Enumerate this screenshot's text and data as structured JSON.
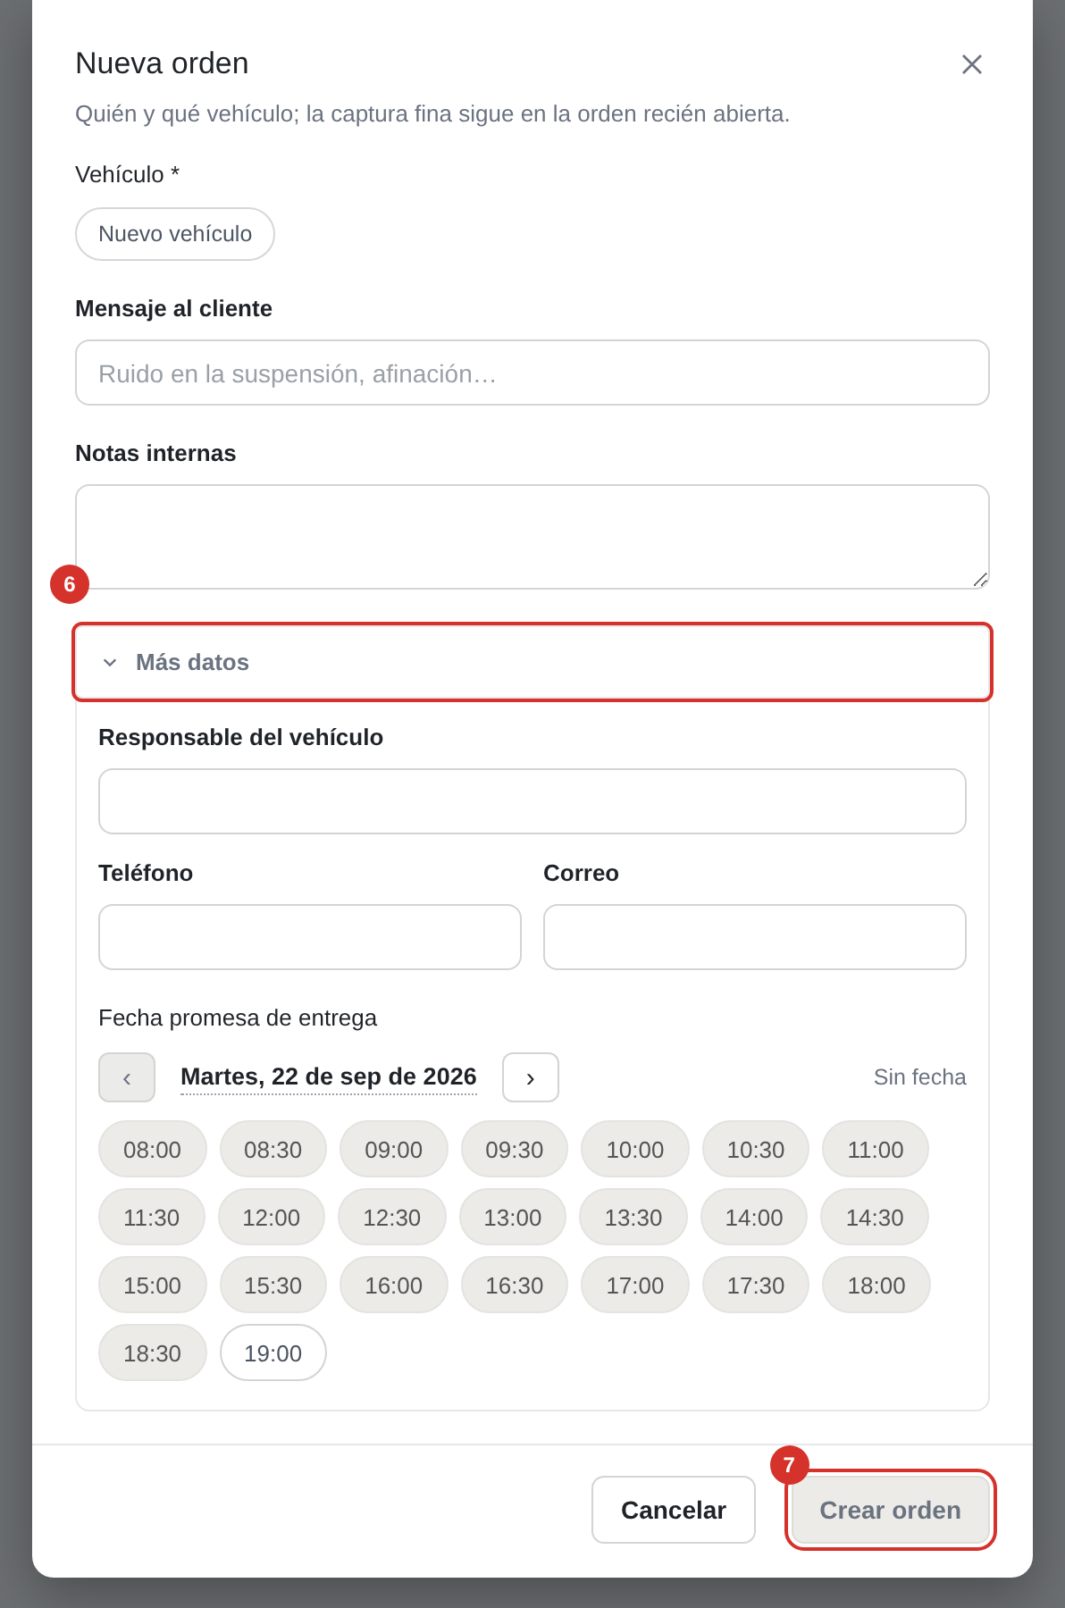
{
  "dialog": {
    "title": "Nueva orden",
    "subtitle": "Quién y qué vehículo; la captura fina sigue en la orden recién abierta.",
    "vehicle": {
      "label": "Vehículo *",
      "button": "Nuevo vehículo"
    },
    "message": {
      "label": "Mensaje al cliente",
      "placeholder": "Ruido en la suspensión, afinación…"
    },
    "notes": {
      "label": "Notas internas"
    },
    "more": {
      "label": "Más datos",
      "expanded": true,
      "annotation": "6",
      "owner": {
        "label": "Responsable del vehículo"
      },
      "contact": [
        {
          "label": "Teléfono"
        },
        {
          "label": "Correo"
        }
      ],
      "schedule": {
        "label": "Fecha promesa de entrega",
        "prev": {
          "glyph": "‹",
          "disabled": true
        },
        "date": "Martes, 22 de sep de 2026",
        "next": {
          "glyph": "›",
          "disabled": false
        },
        "clear": "Sin fecha",
        "slots": [
          {
            "time": "08:00",
            "disabled": true
          },
          {
            "time": "08:30",
            "disabled": true
          },
          {
            "time": "09:00",
            "disabled": true
          },
          {
            "time": "09:30",
            "disabled": true
          },
          {
            "time": "10:00",
            "disabled": true
          },
          {
            "time": "10:30",
            "disabled": true
          },
          {
            "time": "11:00",
            "disabled": true
          },
          {
            "time": "11:30",
            "disabled": true
          },
          {
            "time": "12:00",
            "disabled": true
          },
          {
            "time": "12:30",
            "disabled": true
          },
          {
            "time": "13:00",
            "disabled": true
          },
          {
            "time": "13:30",
            "disabled": true
          },
          {
            "time": "14:00",
            "disabled": true
          },
          {
            "time": "14:30",
            "disabled": true
          },
          {
            "time": "15:00",
            "disabled": true
          },
          {
            "time": "15:30",
            "disabled": true
          },
          {
            "time": "16:00",
            "disabled": true
          },
          {
            "time": "16:30",
            "disabled": true
          },
          {
            "time": "17:00",
            "disabled": true
          },
          {
            "time": "17:30",
            "disabled": true
          },
          {
            "time": "18:00",
            "disabled": true
          },
          {
            "time": "18:30",
            "disabled": true
          },
          {
            "time": "19:00",
            "disabled": false
          }
        ]
      }
    },
    "footer": {
      "buttons": [
        {
          "label": "Cancelar",
          "kind": "secondary",
          "disabled": false
        },
        {
          "label": "Crear orden",
          "kind": "primary",
          "disabled": true,
          "annotation": "7"
        }
      ]
    }
  }
}
